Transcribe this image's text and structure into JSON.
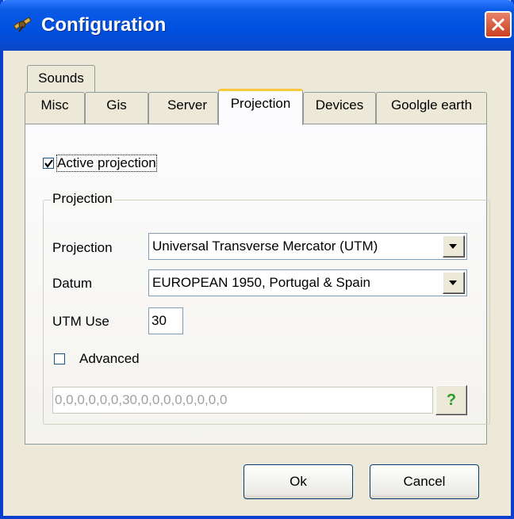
{
  "window": {
    "title": "Configuration",
    "icon": "satellite-icon",
    "close_icon": "close-icon",
    "accent_color": "#0054e3"
  },
  "tabs": {
    "row_back": [
      {
        "label": "Sounds"
      }
    ],
    "row_front": [
      {
        "label": "Misc"
      },
      {
        "label": "Gis"
      },
      {
        "label": "Server"
      },
      {
        "label": "Projection",
        "active": true
      },
      {
        "label": "Devices"
      },
      {
        "label": "Goolgle earth"
      }
    ]
  },
  "projection_tab": {
    "active_projection": {
      "label": "Active projection",
      "checked": true
    },
    "group_title": "Projection",
    "projection_field": {
      "label": "Projection",
      "value": "Universal Transverse Mercator (UTM)"
    },
    "datum_field": {
      "label": "Datum",
      "value": "EUROPEAN 1950, Portugal & Spain"
    },
    "utm_field": {
      "label": "UTM Use",
      "value": "30"
    },
    "advanced": {
      "label": "Advanced",
      "checked": false
    },
    "params_value": "0,0,0,0,0,0,30,0,0,0,0,0,0,0,0",
    "help_label": "?"
  },
  "buttons": {
    "ok": "Ok",
    "cancel": "Cancel"
  }
}
